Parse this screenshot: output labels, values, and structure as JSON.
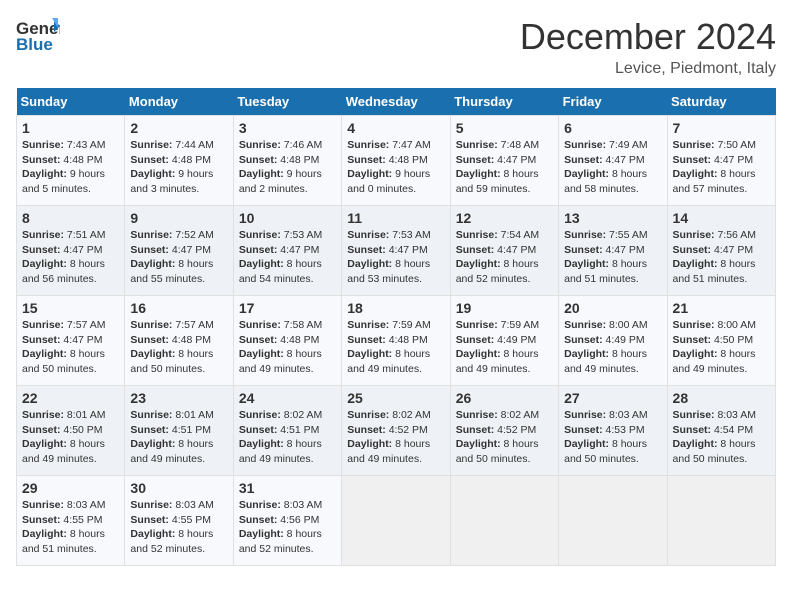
{
  "header": {
    "logo_general": "General",
    "logo_blue": "Blue",
    "month_title": "December 2024",
    "location": "Levice, Piedmont, Italy"
  },
  "days_of_week": [
    "Sunday",
    "Monday",
    "Tuesday",
    "Wednesday",
    "Thursday",
    "Friday",
    "Saturday"
  ],
  "weeks": [
    [
      {
        "day": 1,
        "sunrise": "7:43 AM",
        "sunset": "4:48 PM",
        "daylight": "9 hours and 5 minutes."
      },
      {
        "day": 2,
        "sunrise": "7:44 AM",
        "sunset": "4:48 PM",
        "daylight": "9 hours and 3 minutes."
      },
      {
        "day": 3,
        "sunrise": "7:46 AM",
        "sunset": "4:48 PM",
        "daylight": "9 hours and 2 minutes."
      },
      {
        "day": 4,
        "sunrise": "7:47 AM",
        "sunset": "4:48 PM",
        "daylight": "9 hours and 0 minutes."
      },
      {
        "day": 5,
        "sunrise": "7:48 AM",
        "sunset": "4:47 PM",
        "daylight": "8 hours and 59 minutes."
      },
      {
        "day": 6,
        "sunrise": "7:49 AM",
        "sunset": "4:47 PM",
        "daylight": "8 hours and 58 minutes."
      },
      {
        "day": 7,
        "sunrise": "7:50 AM",
        "sunset": "4:47 PM",
        "daylight": "8 hours and 57 minutes."
      }
    ],
    [
      {
        "day": 8,
        "sunrise": "7:51 AM",
        "sunset": "4:47 PM",
        "daylight": "8 hours and 56 minutes."
      },
      {
        "day": 9,
        "sunrise": "7:52 AM",
        "sunset": "4:47 PM",
        "daylight": "8 hours and 55 minutes."
      },
      {
        "day": 10,
        "sunrise": "7:53 AM",
        "sunset": "4:47 PM",
        "daylight": "8 hours and 54 minutes."
      },
      {
        "day": 11,
        "sunrise": "7:53 AM",
        "sunset": "4:47 PM",
        "daylight": "8 hours and 53 minutes."
      },
      {
        "day": 12,
        "sunrise": "7:54 AM",
        "sunset": "4:47 PM",
        "daylight": "8 hours and 52 minutes."
      },
      {
        "day": 13,
        "sunrise": "7:55 AM",
        "sunset": "4:47 PM",
        "daylight": "8 hours and 51 minutes."
      },
      {
        "day": 14,
        "sunrise": "7:56 AM",
        "sunset": "4:47 PM",
        "daylight": "8 hours and 51 minutes."
      }
    ],
    [
      {
        "day": 15,
        "sunrise": "7:57 AM",
        "sunset": "4:47 PM",
        "daylight": "8 hours and 50 minutes."
      },
      {
        "day": 16,
        "sunrise": "7:57 AM",
        "sunset": "4:48 PM",
        "daylight": "8 hours and 50 minutes."
      },
      {
        "day": 17,
        "sunrise": "7:58 AM",
        "sunset": "4:48 PM",
        "daylight": "8 hours and 49 minutes."
      },
      {
        "day": 18,
        "sunrise": "7:59 AM",
        "sunset": "4:48 PM",
        "daylight": "8 hours and 49 minutes."
      },
      {
        "day": 19,
        "sunrise": "7:59 AM",
        "sunset": "4:49 PM",
        "daylight": "8 hours and 49 minutes."
      },
      {
        "day": 20,
        "sunrise": "8:00 AM",
        "sunset": "4:49 PM",
        "daylight": "8 hours and 49 minutes."
      },
      {
        "day": 21,
        "sunrise": "8:00 AM",
        "sunset": "4:50 PM",
        "daylight": "8 hours and 49 minutes."
      }
    ],
    [
      {
        "day": 22,
        "sunrise": "8:01 AM",
        "sunset": "4:50 PM",
        "daylight": "8 hours and 49 minutes."
      },
      {
        "day": 23,
        "sunrise": "8:01 AM",
        "sunset": "4:51 PM",
        "daylight": "8 hours and 49 minutes."
      },
      {
        "day": 24,
        "sunrise": "8:02 AM",
        "sunset": "4:51 PM",
        "daylight": "8 hours and 49 minutes."
      },
      {
        "day": 25,
        "sunrise": "8:02 AM",
        "sunset": "4:52 PM",
        "daylight": "8 hours and 49 minutes."
      },
      {
        "day": 26,
        "sunrise": "8:02 AM",
        "sunset": "4:52 PM",
        "daylight": "8 hours and 50 minutes."
      },
      {
        "day": 27,
        "sunrise": "8:03 AM",
        "sunset": "4:53 PM",
        "daylight": "8 hours and 50 minutes."
      },
      {
        "day": 28,
        "sunrise": "8:03 AM",
        "sunset": "4:54 PM",
        "daylight": "8 hours and 50 minutes."
      }
    ],
    [
      {
        "day": 29,
        "sunrise": "8:03 AM",
        "sunset": "4:55 PM",
        "daylight": "8 hours and 51 minutes."
      },
      {
        "day": 30,
        "sunrise": "8:03 AM",
        "sunset": "4:55 PM",
        "daylight": "8 hours and 52 minutes."
      },
      {
        "day": 31,
        "sunrise": "8:03 AM",
        "sunset": "4:56 PM",
        "daylight": "8 hours and 52 minutes."
      },
      null,
      null,
      null,
      null
    ]
  ],
  "labels": {
    "sunrise": "Sunrise:",
    "sunset": "Sunset:",
    "daylight": "Daylight:"
  }
}
